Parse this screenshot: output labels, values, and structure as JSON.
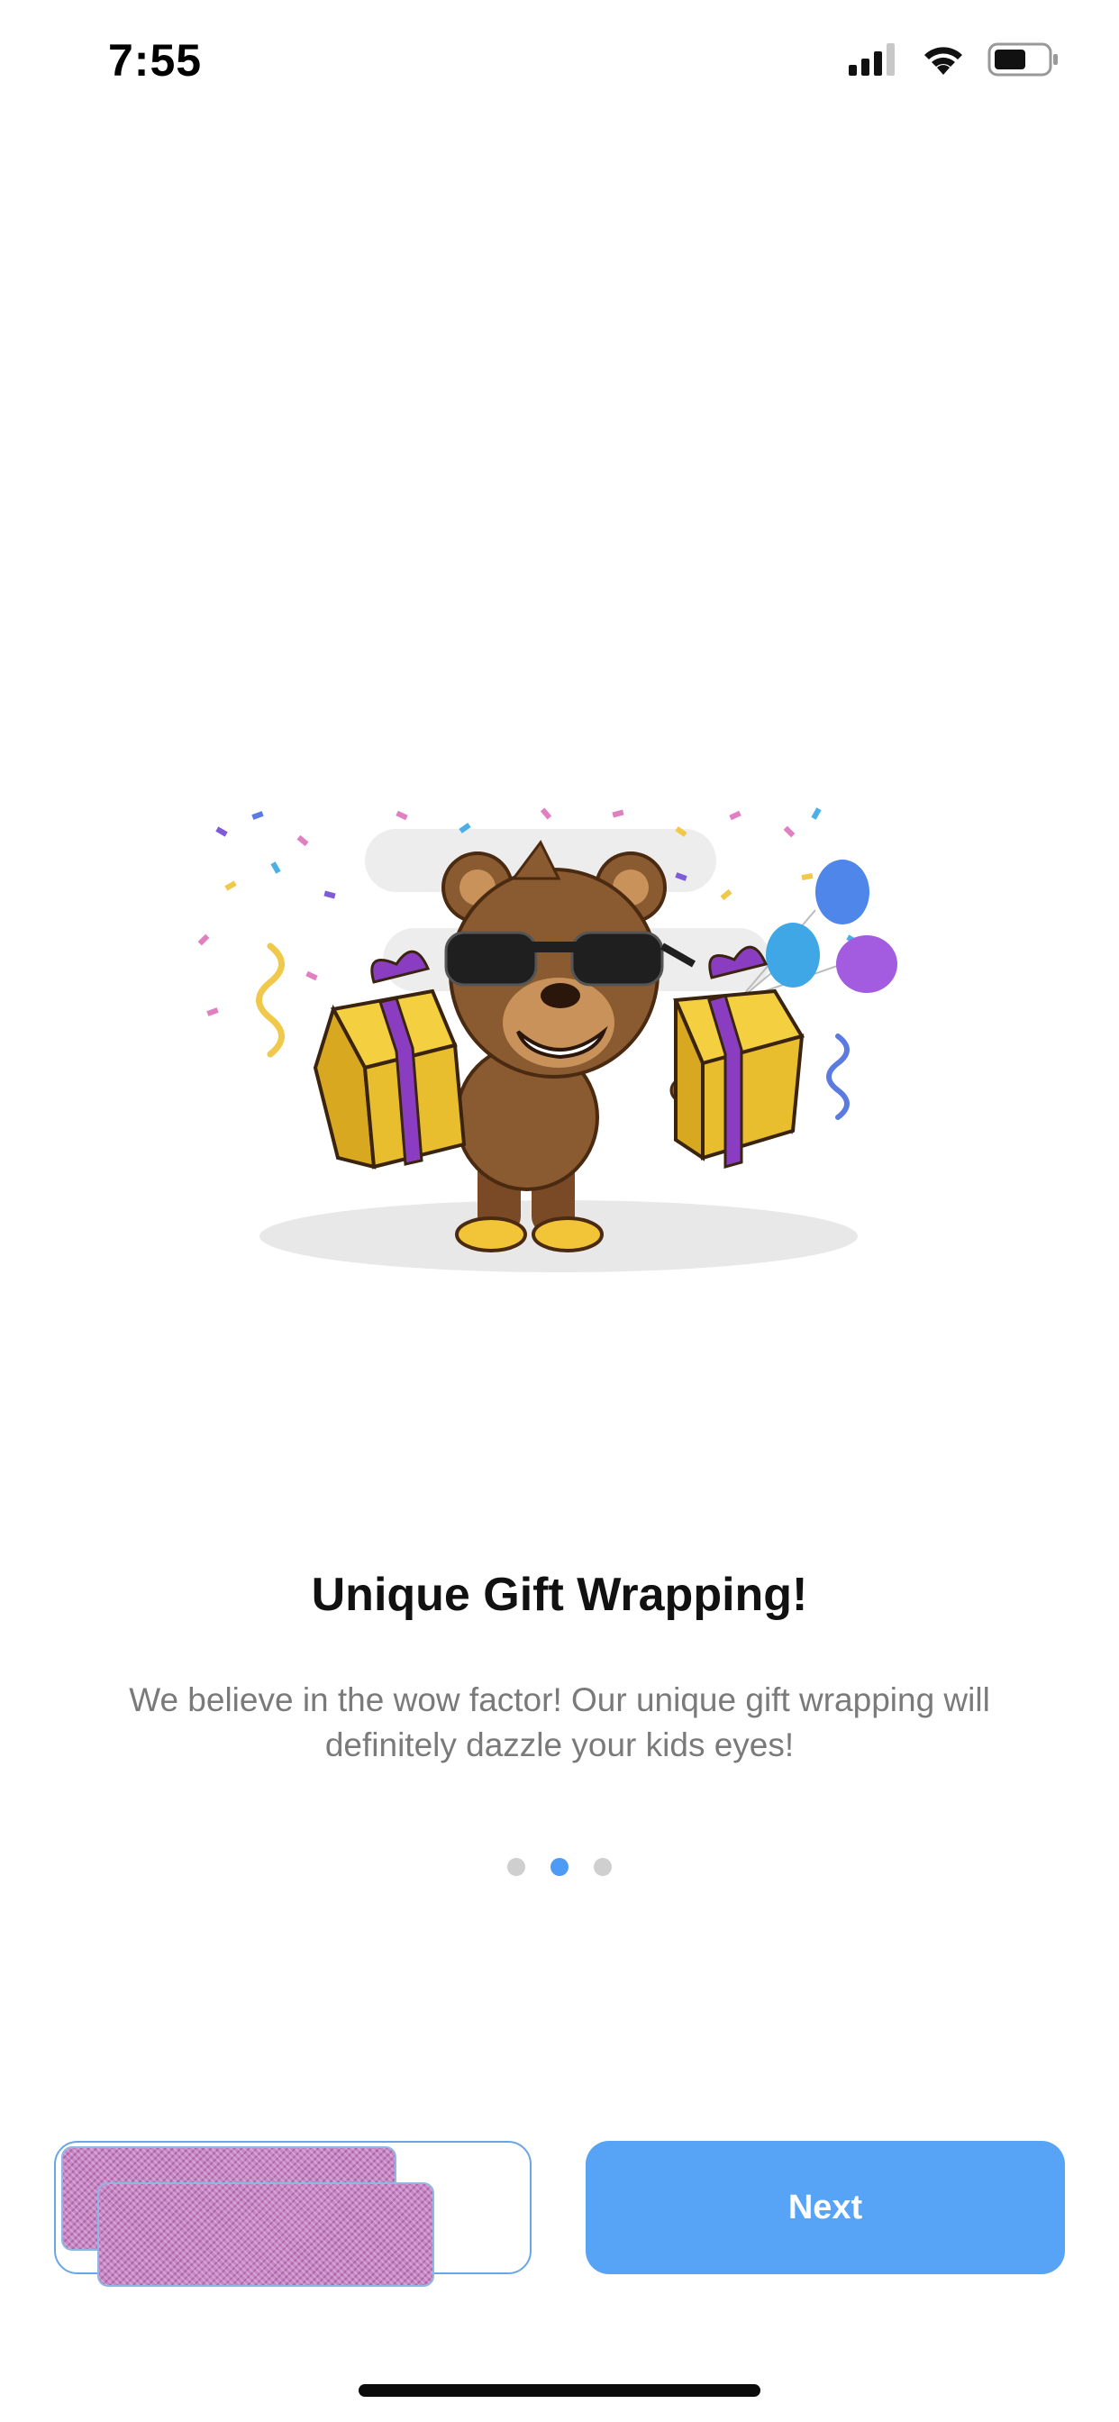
{
  "status_bar": {
    "time": "7:55",
    "icons": [
      "cellular-signal-icon",
      "wifi-icon",
      "battery-icon"
    ]
  },
  "onboarding": {
    "illustration": "teddy-bear-gifts-illustration",
    "title": "Unique Gift Wrapping!",
    "description": "We believe in the wow factor! Our unique gift wrapping will definitely dazzle your kids eyes!",
    "pager": {
      "total": 3,
      "active_index": 1
    }
  },
  "actions": {
    "next_label": "Next"
  },
  "colors": {
    "accent": "#57a3f5",
    "pager_active": "#4e9bf5",
    "pager_inactive": "#cfcfcf",
    "title": "#111111",
    "description": "#7a7a7a"
  }
}
